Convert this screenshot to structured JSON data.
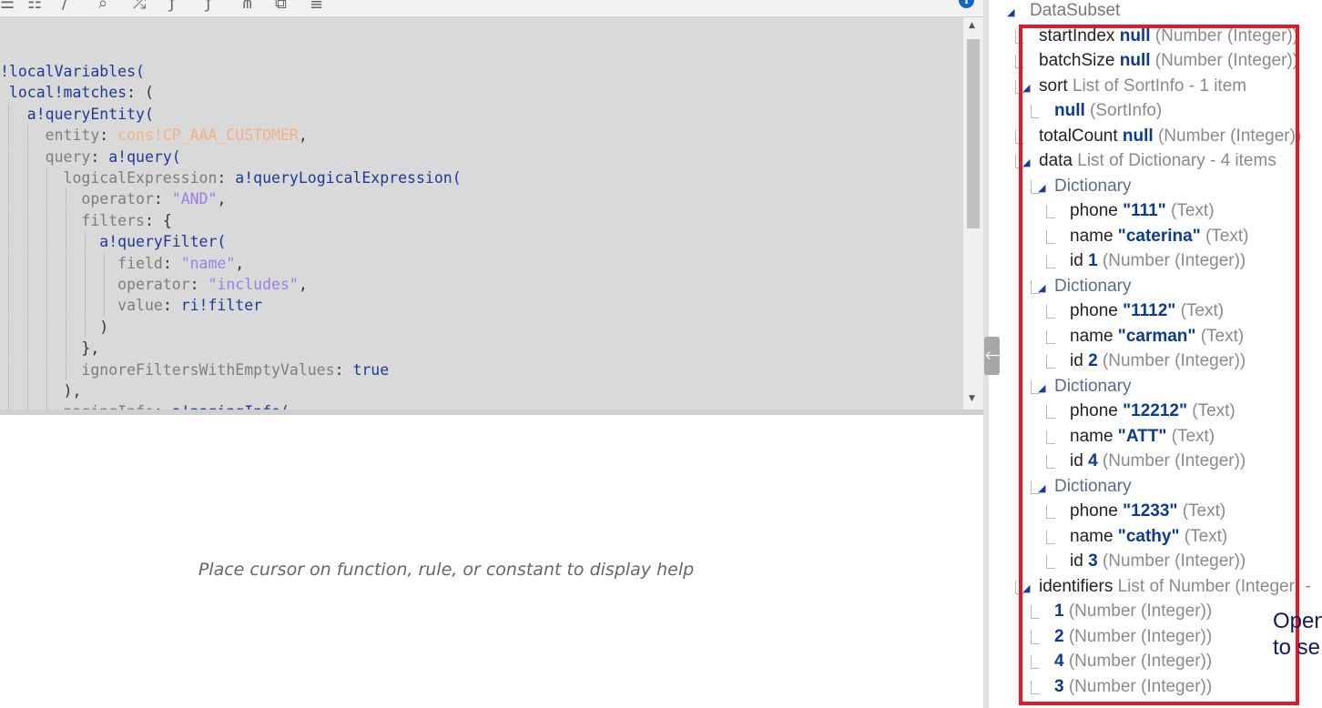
{
  "editor": {
    "lines": [
      [
        [
          "fn",
          "!localVariables("
        ]
      ],
      [
        [
          "fn",
          " local!matches"
        ],
        [
          "pun",
          ": ("
        ]
      ],
      [
        [
          "fn",
          "   a!queryEntity("
        ]
      ],
      [
        [
          "key",
          "     entity"
        ],
        [
          "pun",
          ": "
        ],
        [
          "cons",
          "cons!CP_AAA_CUSTOMER"
        ],
        [
          "pun",
          ","
        ]
      ],
      [
        [
          "key",
          "     query"
        ],
        [
          "pun",
          ": "
        ],
        [
          "fn",
          "a!query("
        ]
      ],
      [
        [
          "key",
          "       logicalExpression"
        ],
        [
          "pun",
          ": "
        ],
        [
          "fn",
          "a!queryLogicalExpression("
        ]
      ],
      [
        [
          "key",
          "         operator"
        ],
        [
          "pun",
          ": "
        ],
        [
          "str",
          "\"AND\""
        ],
        [
          "pun",
          ","
        ]
      ],
      [
        [
          "key",
          "         filters"
        ],
        [
          "pun",
          ": {"
        ]
      ],
      [
        [
          "fn",
          "           a!queryFilter("
        ]
      ],
      [
        [
          "key",
          "             field"
        ],
        [
          "pun",
          ": "
        ],
        [
          "str",
          "\"name\""
        ],
        [
          "pun",
          ","
        ]
      ],
      [
        [
          "key",
          "             operator"
        ],
        [
          "pun",
          ": "
        ],
        [
          "str",
          "\"includes\""
        ],
        [
          "pun",
          ","
        ]
      ],
      [
        [
          "key",
          "             value"
        ],
        [
          "pun",
          ": "
        ],
        [
          "fn",
          "ri!filter"
        ]
      ],
      [
        [
          "pun",
          "           )"
        ]
      ],
      [
        [
          "pun",
          "         },"
        ]
      ],
      [
        [
          "key",
          "         ignoreFiltersWithEmptyValues"
        ],
        [
          "pun",
          ": "
        ],
        [
          "kw",
          "true"
        ]
      ],
      [
        [
          "pun",
          "       ),"
        ]
      ],
      [
        [
          "key",
          "       pagingInfo"
        ],
        [
          "pun",
          ": "
        ],
        [
          "fn",
          "a!pagingInfo("
        ]
      ]
    ],
    "help_text": "Place cursor on function, rule, or constant to display help"
  },
  "tree": {
    "rows": [
      {
        "depth": 0,
        "expanded": true,
        "label": "DataSubset",
        "value": "",
        "type": ""
      },
      {
        "depth": 1,
        "label": "startIndex",
        "value": "null",
        "type": "(Number (Integer))"
      },
      {
        "depth": 1,
        "label": "batchSize",
        "value": "null",
        "type": "(Number (Integer))"
      },
      {
        "depth": 1,
        "expanded": true,
        "label": "sort",
        "value": "",
        "type": "List of SortInfo - 1 item"
      },
      {
        "depth": 2,
        "label": "",
        "value": "null",
        "type": "(SortInfo)"
      },
      {
        "depth": 1,
        "label": "totalCount",
        "value": "null",
        "type": "(Number (Integer))"
      },
      {
        "depth": 1,
        "expanded": true,
        "label": "data",
        "value": "",
        "type": "List of Dictionary - 4 items"
      },
      {
        "depth": 2,
        "expanded": true,
        "label": "Dictionary",
        "value": "",
        "type": "",
        "muted": true
      },
      {
        "depth": 3,
        "label": "phone",
        "value": "\"111\"",
        "type": "(Text)"
      },
      {
        "depth": 3,
        "label": "name",
        "value": "\"caterina\"",
        "type": "(Text)"
      },
      {
        "depth": 3,
        "label": "id",
        "value": "1",
        "type": "(Number (Integer))"
      },
      {
        "depth": 2,
        "expanded": true,
        "label": "Dictionary",
        "value": "",
        "type": "",
        "muted": true
      },
      {
        "depth": 3,
        "label": "phone",
        "value": "\"1112\"",
        "type": "(Text)"
      },
      {
        "depth": 3,
        "label": "name",
        "value": "\"carman\"",
        "type": "(Text)"
      },
      {
        "depth": 3,
        "label": "id",
        "value": "2",
        "type": "(Number (Integer))"
      },
      {
        "depth": 2,
        "expanded": true,
        "label": "Dictionary",
        "value": "",
        "type": "",
        "muted": true
      },
      {
        "depth": 3,
        "label": "phone",
        "value": "\"12212\"",
        "type": "(Text)"
      },
      {
        "depth": 3,
        "label": "name",
        "value": "\"ATT\"",
        "type": "(Text)"
      },
      {
        "depth": 3,
        "label": "id",
        "value": "4",
        "type": "(Number (Integer))"
      },
      {
        "depth": 2,
        "expanded": true,
        "label": "Dictionary",
        "value": "",
        "type": "",
        "muted": true
      },
      {
        "depth": 3,
        "label": "phone",
        "value": "\"1233\"",
        "type": "(Text)"
      },
      {
        "depth": 3,
        "label": "name",
        "value": "\"cathy\"",
        "type": "(Text)"
      },
      {
        "depth": 3,
        "label": "id",
        "value": "3",
        "type": "(Number (Integer))"
      },
      {
        "depth": 1,
        "expanded": true,
        "label": "identifiers",
        "value": "",
        "type": "List of Number (Integer) -"
      },
      {
        "depth": 2,
        "label": "",
        "value": "1",
        "type": "(Number (Integer))"
      },
      {
        "depth": 2,
        "label": "",
        "value": "2",
        "type": "(Number (Integer))"
      },
      {
        "depth": 2,
        "label": "",
        "value": "4",
        "type": "(Number (Integer))"
      },
      {
        "depth": 2,
        "label": "",
        "value": "3",
        "type": "(Number (Integer))"
      }
    ],
    "open_hint": "Open\nto se"
  },
  "colors": {
    "highlight_box": "#e3192a",
    "value_text": "#0b3a91",
    "editor_bg": "#d9d9d9"
  },
  "icons": {
    "toolbar": [
      "list-icon",
      "numbered-list-icon",
      "comment-icon",
      "search-icon",
      "shuffle-icon",
      "function-icon",
      "rule-icon",
      "expression-icon",
      "copy-icon",
      "find-icon"
    ],
    "help": "help-icon",
    "collapse": "arrow-left-icon",
    "tree_toggle": "triangle-expanded-icon"
  }
}
